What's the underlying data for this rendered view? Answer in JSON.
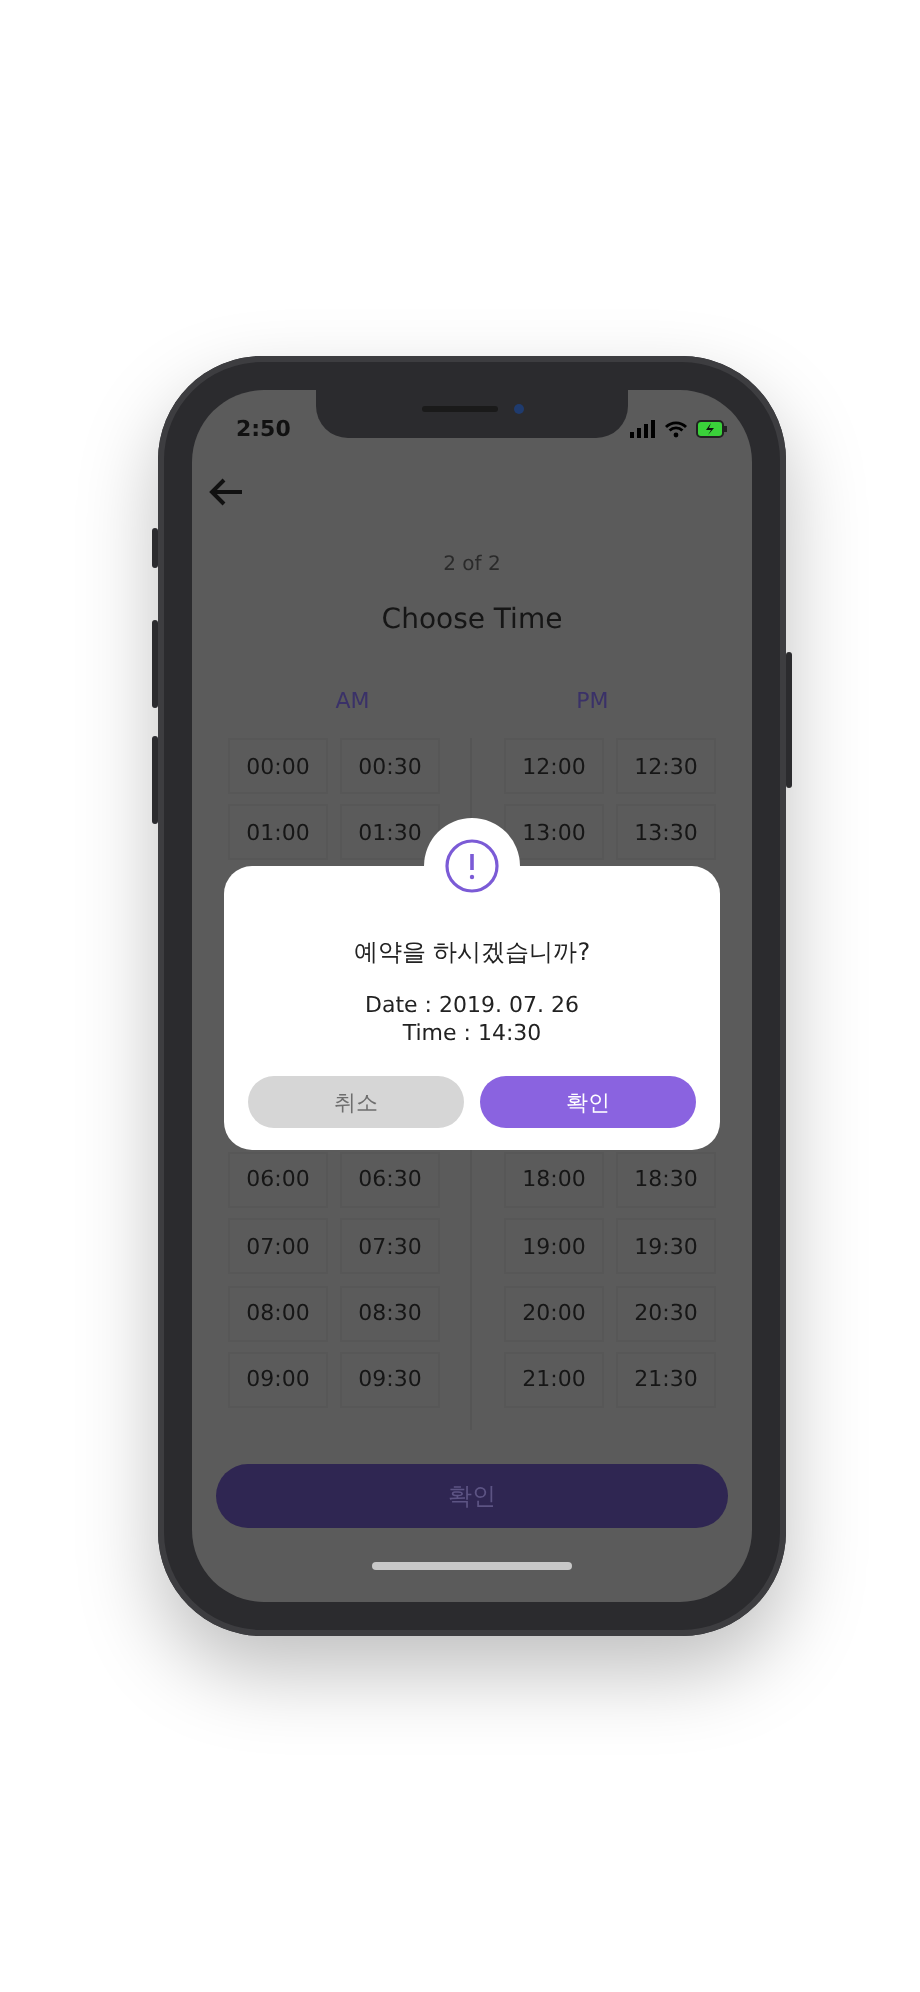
{
  "status_bar": {
    "time": "2:50"
  },
  "header": {
    "step": "2 of 2",
    "title": "Choose Time"
  },
  "time_slots": {
    "am_label": "AM",
    "pm_label": "PM",
    "top_rows": [
      {
        "am": [
          "00:00",
          "00:30"
        ],
        "pm": [
          "12:00",
          "12:30"
        ]
      },
      {
        "am": [
          "01:00",
          "01:30"
        ],
        "pm": [
          "13:00",
          "13:30"
        ]
      }
    ],
    "bottom_rows": [
      {
        "am": [
          "06:00",
          "06:30"
        ],
        "pm": [
          "18:00",
          "18:30"
        ]
      },
      {
        "am": [
          "07:00",
          "07:30"
        ],
        "pm": [
          "19:00",
          "19:30"
        ]
      },
      {
        "am": [
          "08:00",
          "08:30"
        ],
        "pm": [
          "20:00",
          "20:30"
        ]
      },
      {
        "am": [
          "09:00",
          "09:30"
        ],
        "pm": [
          "21:00",
          "21:30"
        ]
      }
    ]
  },
  "footer": {
    "button": "확인"
  },
  "dialog": {
    "message": "예약을 하시겠습니까?",
    "details": [
      "Date : 2019. 07. 26",
      "Time : 14:30"
    ],
    "buttons": [
      {
        "label": "취소",
        "kind": "cancel"
      },
      {
        "label": "확인",
        "kind": "confirm"
      }
    ]
  }
}
